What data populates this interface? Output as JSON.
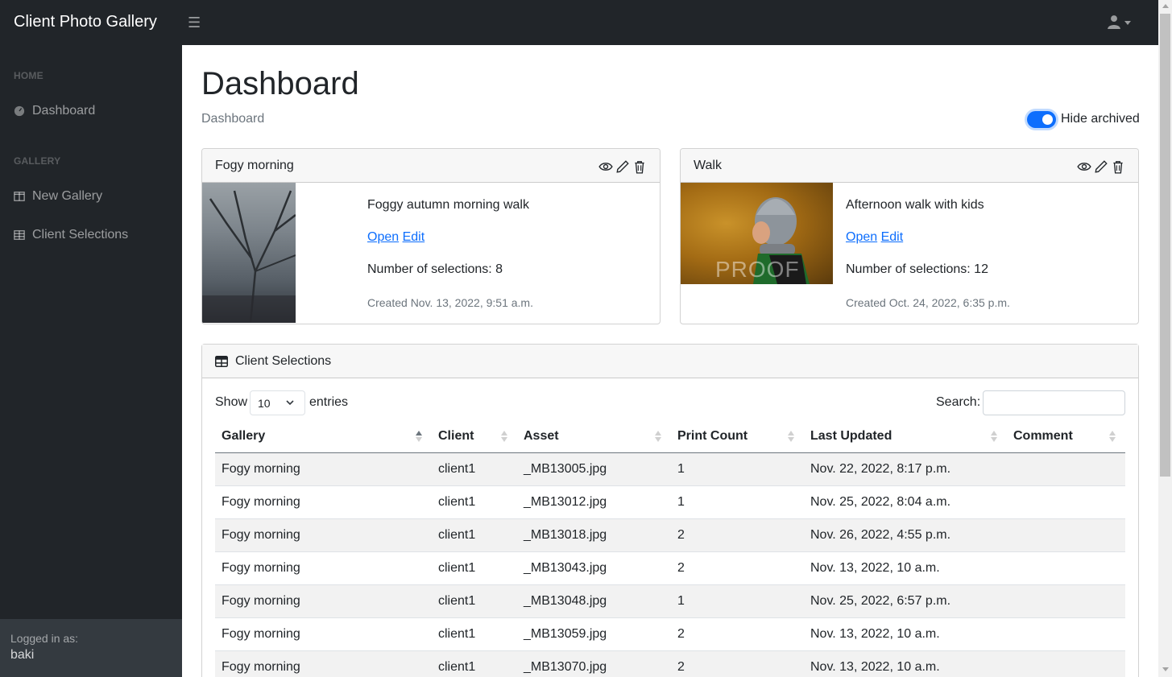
{
  "app": {
    "title": "Client Photo Gallery"
  },
  "sidebar": {
    "sections": [
      {
        "heading": "HOME",
        "items": [
          {
            "label": "Dashboard",
            "icon": "gauge-icon"
          }
        ]
      },
      {
        "heading": "GALLERY",
        "items": [
          {
            "label": "New Gallery",
            "icon": "columns-icon"
          },
          {
            "label": "Client Selections",
            "icon": "table-icon"
          }
        ]
      }
    ],
    "footer": {
      "label": "Logged in as:",
      "user": "baki"
    }
  },
  "page": {
    "title": "Dashboard",
    "breadcrumb": "Dashboard",
    "hide_archived": {
      "label": "Hide archived",
      "checked": true,
      "color": "#0d6efd"
    }
  },
  "galleries": [
    {
      "title": "Fogy morning",
      "description": "Foggy autumn morning walk",
      "open_label": "Open",
      "edit_label": "Edit",
      "selections": "Number of selections: 8",
      "created": "Created Nov. 13, 2022, 9:51 a.m."
    },
    {
      "title": "Walk",
      "description": "Afternoon walk with kids",
      "open_label": "Open",
      "edit_label": "Edit",
      "selections": "Number of selections: 12",
      "created": "Created Oct. 24, 2022, 6:35 p.m.",
      "watermark": "PROOF"
    }
  ],
  "selections_card": {
    "title": "Client Selections",
    "show_label": "Show",
    "page_length": "10",
    "entries_label": "entries",
    "search_label": "Search:",
    "search_value": "",
    "columns": [
      "Gallery",
      "Client",
      "Asset",
      "Print Count",
      "Last Updated",
      "Comment"
    ],
    "rows": [
      [
        "Fogy morning",
        "client1",
        "_MB13005.jpg",
        "1",
        "Nov. 22, 2022, 8:17 p.m.",
        ""
      ],
      [
        "Fogy morning",
        "client1",
        "_MB13012.jpg",
        "1",
        "Nov. 25, 2022, 8:04 a.m.",
        ""
      ],
      [
        "Fogy morning",
        "client1",
        "_MB13018.jpg",
        "2",
        "Nov. 26, 2022, 4:55 p.m.",
        ""
      ],
      [
        "Fogy morning",
        "client1",
        "_MB13043.jpg",
        "2",
        "Nov. 13, 2022, 10 a.m.",
        ""
      ],
      [
        "Fogy morning",
        "client1",
        "_MB13048.jpg",
        "1",
        "Nov. 25, 2022, 6:57 p.m.",
        ""
      ],
      [
        "Fogy morning",
        "client1",
        "_MB13059.jpg",
        "2",
        "Nov. 13, 2022, 10 a.m.",
        ""
      ],
      [
        "Fogy morning",
        "client1",
        "_MB13070.jpg",
        "2",
        "Nov. 13, 2022, 10 a.m.",
        ""
      ]
    ]
  }
}
